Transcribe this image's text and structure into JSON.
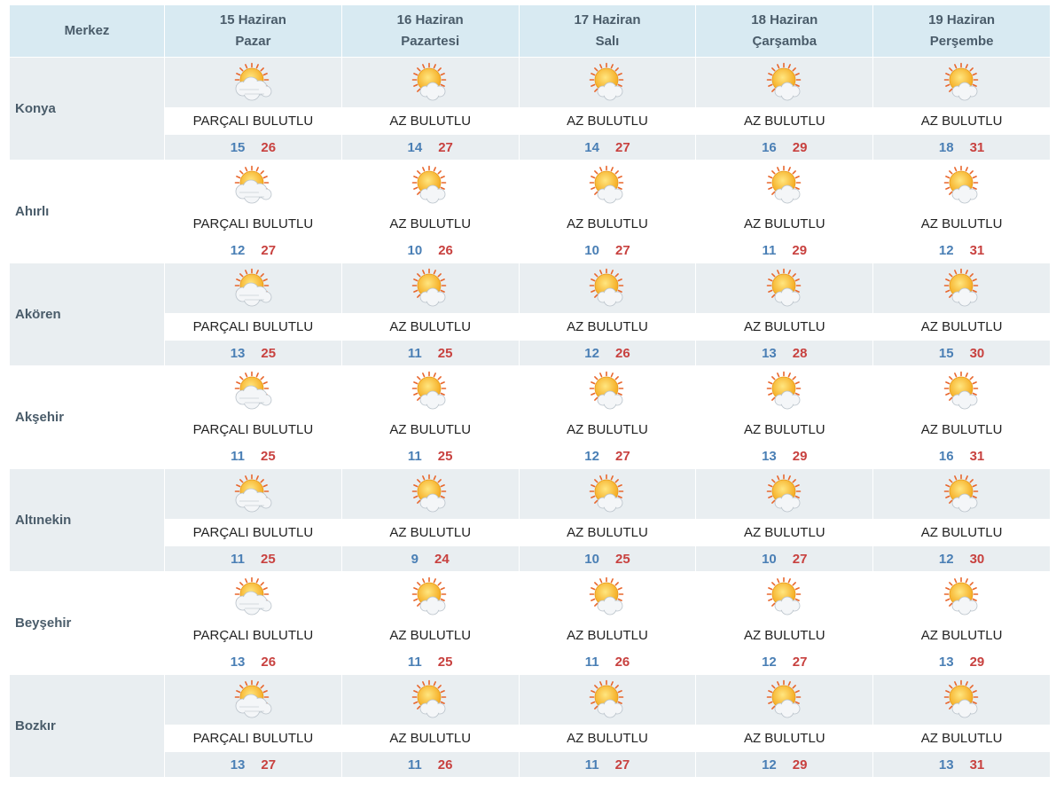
{
  "header": {
    "center_label": "Merkez",
    "days": [
      {
        "date": "15 Haziran",
        "day": "Pazar"
      },
      {
        "date": "16 Haziran",
        "day": "Pazartesi"
      },
      {
        "date": "17 Haziran",
        "day": "Salı"
      },
      {
        "date": "18 Haziran",
        "day": "Çarşamba"
      },
      {
        "date": "19 Haziran",
        "day": "Perşembe"
      }
    ]
  },
  "cities": [
    {
      "name": "Konya",
      "forecast": [
        {
          "icon": "partly-cloudy-icon",
          "desc": "PARÇALI BULUTLU",
          "min": "15",
          "max": "26"
        },
        {
          "icon": "mostly-sunny-icon",
          "desc": "AZ BULUTLU",
          "min": "14",
          "max": "27"
        },
        {
          "icon": "mostly-sunny-icon",
          "desc": "AZ BULUTLU",
          "min": "14",
          "max": "27"
        },
        {
          "icon": "mostly-sunny-icon",
          "desc": "AZ BULUTLU",
          "min": "16",
          "max": "29"
        },
        {
          "icon": "mostly-sunny-icon",
          "desc": "AZ BULUTLU",
          "min": "18",
          "max": "31"
        }
      ]
    },
    {
      "name": "Ahırlı",
      "forecast": [
        {
          "icon": "partly-cloudy-icon",
          "desc": "PARÇALI BULUTLU",
          "min": "12",
          "max": "27"
        },
        {
          "icon": "mostly-sunny-icon",
          "desc": "AZ BULUTLU",
          "min": "10",
          "max": "26"
        },
        {
          "icon": "mostly-sunny-icon",
          "desc": "AZ BULUTLU",
          "min": "10",
          "max": "27"
        },
        {
          "icon": "mostly-sunny-icon",
          "desc": "AZ BULUTLU",
          "min": "11",
          "max": "29"
        },
        {
          "icon": "mostly-sunny-icon",
          "desc": "AZ BULUTLU",
          "min": "12",
          "max": "31"
        }
      ]
    },
    {
      "name": "Akören",
      "forecast": [
        {
          "icon": "partly-cloudy-icon",
          "desc": "PARÇALI BULUTLU",
          "min": "13",
          "max": "25"
        },
        {
          "icon": "mostly-sunny-icon",
          "desc": "AZ BULUTLU",
          "min": "11",
          "max": "25"
        },
        {
          "icon": "mostly-sunny-icon",
          "desc": "AZ BULUTLU",
          "min": "12",
          "max": "26"
        },
        {
          "icon": "mostly-sunny-icon",
          "desc": "AZ BULUTLU",
          "min": "13",
          "max": "28"
        },
        {
          "icon": "mostly-sunny-icon",
          "desc": "AZ BULUTLU",
          "min": "15",
          "max": "30"
        }
      ]
    },
    {
      "name": "Akşehir",
      "forecast": [
        {
          "icon": "partly-cloudy-icon",
          "desc": "PARÇALI BULUTLU",
          "min": "11",
          "max": "25"
        },
        {
          "icon": "mostly-sunny-icon",
          "desc": "AZ BULUTLU",
          "min": "11",
          "max": "25"
        },
        {
          "icon": "mostly-sunny-icon",
          "desc": "AZ BULUTLU",
          "min": "12",
          "max": "27"
        },
        {
          "icon": "mostly-sunny-icon",
          "desc": "AZ BULUTLU",
          "min": "13",
          "max": "29"
        },
        {
          "icon": "mostly-sunny-icon",
          "desc": "AZ BULUTLU",
          "min": "16",
          "max": "31"
        }
      ]
    },
    {
      "name": "Altınekin",
      "forecast": [
        {
          "icon": "partly-cloudy-icon",
          "desc": "PARÇALI BULUTLU",
          "min": "11",
          "max": "25"
        },
        {
          "icon": "mostly-sunny-icon",
          "desc": "AZ BULUTLU",
          "min": "9",
          "max": "24"
        },
        {
          "icon": "mostly-sunny-icon",
          "desc": "AZ BULUTLU",
          "min": "10",
          "max": "25"
        },
        {
          "icon": "mostly-sunny-icon",
          "desc": "AZ BULUTLU",
          "min": "10",
          "max": "27"
        },
        {
          "icon": "mostly-sunny-icon",
          "desc": "AZ BULUTLU",
          "min": "12",
          "max": "30"
        }
      ]
    },
    {
      "name": "Beyşehir",
      "forecast": [
        {
          "icon": "partly-cloudy-icon",
          "desc": "PARÇALI BULUTLU",
          "min": "13",
          "max": "26"
        },
        {
          "icon": "mostly-sunny-icon",
          "desc": "AZ BULUTLU",
          "min": "11",
          "max": "25"
        },
        {
          "icon": "mostly-sunny-icon",
          "desc": "AZ BULUTLU",
          "min": "11",
          "max": "26"
        },
        {
          "icon": "mostly-sunny-icon",
          "desc": "AZ BULUTLU",
          "min": "12",
          "max": "27"
        },
        {
          "icon": "mostly-sunny-icon",
          "desc": "AZ BULUTLU",
          "min": "13",
          "max": "29"
        }
      ]
    },
    {
      "name": "Bozkır",
      "forecast": [
        {
          "icon": "partly-cloudy-icon",
          "desc": "PARÇALI BULUTLU",
          "min": "13",
          "max": "27"
        },
        {
          "icon": "mostly-sunny-icon",
          "desc": "AZ BULUTLU",
          "min": "11",
          "max": "26"
        },
        {
          "icon": "mostly-sunny-icon",
          "desc": "AZ BULUTLU",
          "min": "11",
          "max": "27"
        },
        {
          "icon": "mostly-sunny-icon",
          "desc": "AZ BULUTLU",
          "min": "12",
          "max": "29"
        },
        {
          "icon": "mostly-sunny-icon",
          "desc": "AZ BULUTLU",
          "min": "13",
          "max": "31"
        }
      ]
    }
  ],
  "colors": {
    "header_bg": "#d8eaf2",
    "row_shade": "#e9eef1",
    "min_temp": "#4a7fb5",
    "max_temp": "#c8413f",
    "label_text": "#4a5c6a"
  }
}
